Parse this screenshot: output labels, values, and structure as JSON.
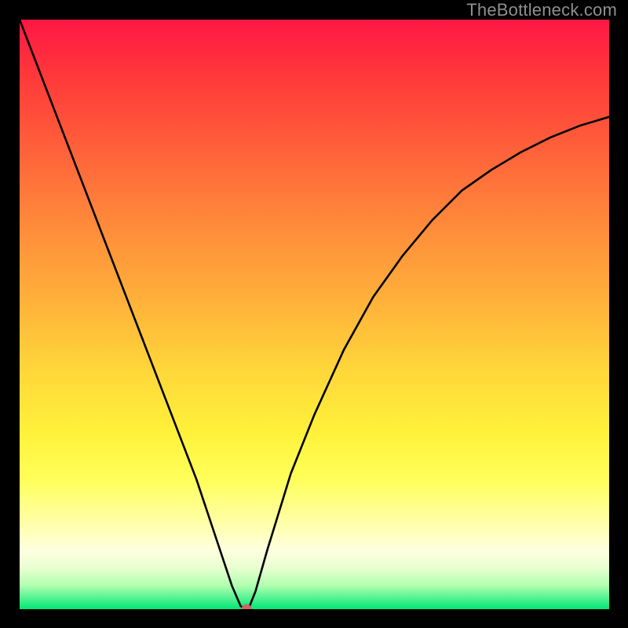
{
  "watermark": "TheBottleneck.com",
  "chart_data": {
    "type": "line",
    "title": "",
    "xlabel": "",
    "ylabel": "",
    "xlim": [
      0,
      100
    ],
    "ylim": [
      0,
      100
    ],
    "background_gradient": {
      "top": "#ff1744",
      "middle": "#ffeb3b",
      "bottom": "#00e676",
      "meaning": "V-shaped bottleneck curve — minimum near x≈38"
    },
    "series": [
      {
        "name": "bottleneck-curve",
        "type": "line",
        "color": "#000000",
        "x": [
          0,
          5,
          10,
          15,
          20,
          25,
          30,
          34,
          36,
          37.5,
          38.5,
          39,
          40,
          42,
          46,
          50,
          55,
          60,
          65,
          70,
          75,
          80,
          85,
          90,
          95,
          100
        ],
        "y": [
          100,
          87,
          74,
          61,
          48,
          35,
          22,
          10,
          4,
          0.5,
          0,
          0.5,
          3,
          10,
          23,
          33,
          44,
          53,
          60,
          66,
          71,
          74.5,
          77.5,
          80,
          82,
          83.5
        ]
      },
      {
        "name": "marker",
        "type": "scatter",
        "color": "#cc6060",
        "x": [
          38.5
        ],
        "y": [
          0
        ]
      }
    ]
  }
}
